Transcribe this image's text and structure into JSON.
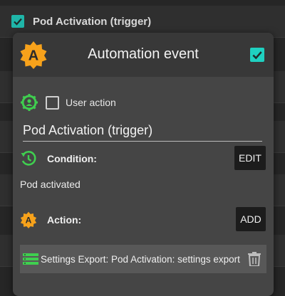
{
  "background": {
    "first_item_title": "Pod Activation (trigger)",
    "first_item_checked": true
  },
  "dialog": {
    "title": "Automation event",
    "enabled_checked": true,
    "user_action": {
      "label": "User action",
      "checked": false
    },
    "name_value": "Pod Activation (trigger)",
    "condition": {
      "label": "Condition:",
      "edit_label": "EDIT",
      "value": "Pod activated"
    },
    "action": {
      "label": "Action:",
      "add_label": "ADD"
    },
    "actions": [
      {
        "text": "Settings Export: Pod Activation: settings export"
      }
    ]
  },
  "colors": {
    "accent_teal": "#1fd0c0",
    "icon_green": "#3fcf4f",
    "icon_orange": "#f7a21b"
  },
  "icons": [
    "checkmark-icon",
    "app-logo-icon",
    "gear-person-icon",
    "clock-condition-icon",
    "action-logo-icon",
    "list-icon",
    "trash-icon"
  ]
}
